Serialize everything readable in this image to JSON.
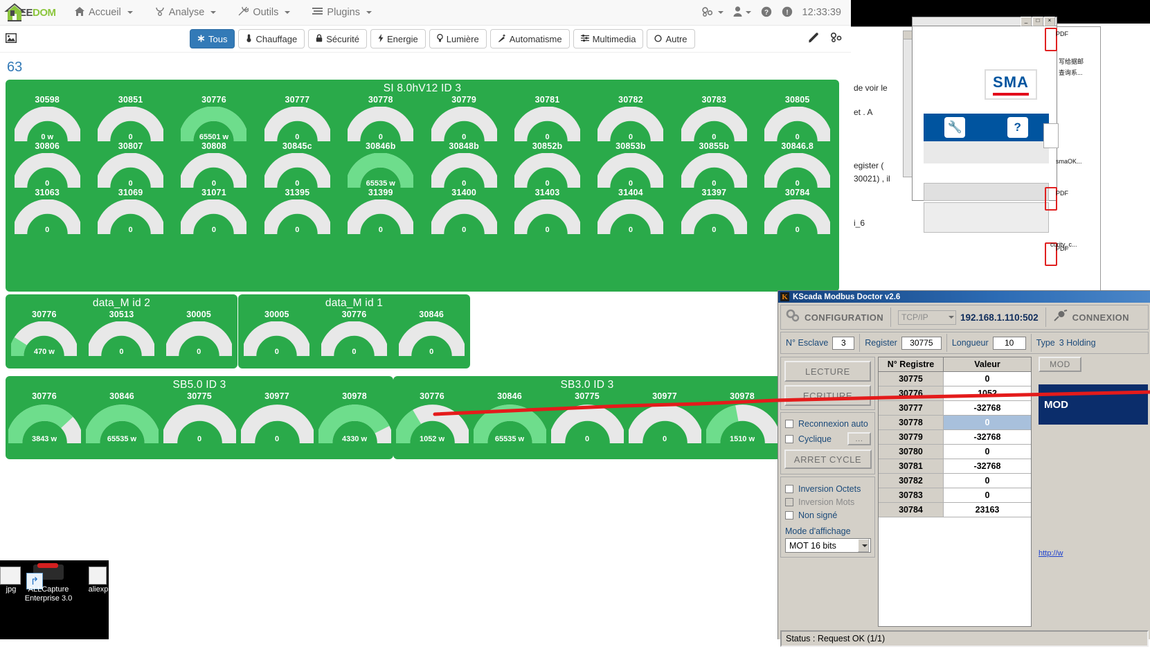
{
  "jeedom": {
    "brand": {
      "ee": "EE",
      "dom": "DOM"
    },
    "nav": [
      {
        "label": "Accueil",
        "icon": "home-icon"
      },
      {
        "label": "Analyse",
        "icon": "chart-icon"
      },
      {
        "label": "Outils",
        "icon": "wrench-icon"
      },
      {
        "label": "Plugins",
        "icon": "list-icon"
      }
    ],
    "nav_right": {
      "gears": "⚙",
      "user": "user-icon",
      "help": "?",
      "info": "!",
      "clock": "12:33:39"
    },
    "categories": [
      {
        "label": "Tous",
        "icon": "asterisk-icon",
        "active": true
      },
      {
        "label": "Chauffage",
        "icon": "thermometer-icon",
        "active": false
      },
      {
        "label": "Sécurité",
        "icon": "lock-icon",
        "active": false
      },
      {
        "label": "Energie",
        "icon": "bolt-icon",
        "active": false
      },
      {
        "label": "Lumière",
        "icon": "bulb-icon",
        "active": false
      },
      {
        "label": "Automatisme",
        "icon": "magic-icon",
        "active": false
      },
      {
        "label": "Multimedia",
        "icon": "sliders-icon",
        "active": false
      },
      {
        "label": "Autre",
        "icon": "circle-icon",
        "active": false
      }
    ],
    "page_number": "63",
    "panels": [
      {
        "id": "si80hv12",
        "title": "SI 8.0hV12 ID 3",
        "rows": [
          [
            {
              "label": "30598",
              "value": "0 w",
              "pct": 0
            },
            {
              "label": "30851",
              "value": "0",
              "pct": 0
            },
            {
              "label": "30776",
              "value": "65501 w",
              "pct": 100
            },
            {
              "label": "30777",
              "value": "0",
              "pct": 0
            },
            {
              "label": "30778",
              "value": "0",
              "pct": 0
            },
            {
              "label": "30779",
              "value": "0",
              "pct": 0
            },
            {
              "label": "30781",
              "value": "0",
              "pct": 0
            },
            {
              "label": "30782",
              "value": "0",
              "pct": 0
            },
            {
              "label": "30783",
              "value": "0",
              "pct": 0
            },
            {
              "label": "30805",
              "value": "0",
              "pct": 0
            }
          ],
          [
            {
              "label": "30806",
              "value": "0",
              "pct": 0
            },
            {
              "label": "30807",
              "value": "0",
              "pct": 0
            },
            {
              "label": "30808",
              "value": "0",
              "pct": 0
            },
            {
              "label": "30845c",
              "value": "0",
              "pct": 0
            },
            {
              "label": "30846b",
              "value": "65535 w",
              "pct": 100
            },
            {
              "label": "30848b",
              "value": "0",
              "pct": 0
            },
            {
              "label": "30852b",
              "value": "0",
              "pct": 0
            },
            {
              "label": "30853b",
              "value": "0",
              "pct": 0
            },
            {
              "label": "30855b",
              "value": "0",
              "pct": 0
            },
            {
              "label": "30846.8",
              "value": "0",
              "pct": 0
            }
          ],
          [
            {
              "label": "31063",
              "value": "0",
              "pct": 0
            },
            {
              "label": "31069",
              "value": "0",
              "pct": 0
            },
            {
              "label": "31071",
              "value": "0",
              "pct": 0
            },
            {
              "label": "31395",
              "value": "0",
              "pct": 0
            },
            {
              "label": "31399",
              "value": "0",
              "pct": 0
            },
            {
              "label": "31400",
              "value": "0",
              "pct": 0
            },
            {
              "label": "31403",
              "value": "0",
              "pct": 0
            },
            {
              "label": "31404",
              "value": "0",
              "pct": 0
            },
            {
              "label": "31397",
              "value": "0",
              "pct": 0
            },
            {
              "label": "30784",
              "value": "0",
              "pct": 0
            }
          ]
        ]
      },
      {
        "id": "data_m_id2",
        "title": "data_M id 2",
        "rows": [
          [
            {
              "label": "30776",
              "value": "470 w",
              "pct": 18
            },
            {
              "label": "30513",
              "value": "0",
              "pct": 0
            },
            {
              "label": "30005",
              "value": "0",
              "pct": 0
            }
          ]
        ]
      },
      {
        "id": "data_m_id1",
        "title": "data_M id 1",
        "rows": [
          [
            {
              "label": "30005",
              "value": "0",
              "pct": 0
            },
            {
              "label": "30776",
              "value": "0",
              "pct": 0
            },
            {
              "label": "30846",
              "value": "0",
              "pct": 0
            }
          ]
        ]
      },
      {
        "id": "sb50id3",
        "title": "SB5.0 ID 3",
        "rows": [
          [
            {
              "label": "30776",
              "value": "3843 w",
              "pct": 76
            },
            {
              "label": "30846",
              "value": "65535 w",
              "pct": 100
            },
            {
              "label": "30775",
              "value": "0",
              "pct": 0
            },
            {
              "label": "30977",
              "value": "0",
              "pct": 0
            },
            {
              "label": "30978",
              "value": "4330 w",
              "pct": 85
            }
          ]
        ]
      },
      {
        "id": "sb30id3",
        "title": "SB3.0 ID 3",
        "rows": [
          [
            {
              "label": "30776",
              "value": "1052 w",
              "pct": 33
            },
            {
              "label": "30846",
              "value": "65535 w",
              "pct": 100
            },
            {
              "label": "30775",
              "value": "0",
              "pct": 0
            },
            {
              "label": "30977",
              "value": "0",
              "pct": 0
            },
            {
              "label": "30978",
              "value": "1510 w",
              "pct": 44
            }
          ]
        ]
      }
    ],
    "colors": {
      "panel_green": "#2aaa4a",
      "gauge_fill": "#6edd8c",
      "gauge_track": "#e8e8e8",
      "accent_blue": "#337ab7"
    }
  },
  "modbus": {
    "title": "KScada Modbus Doctor v2.6",
    "config_label": "CONFIGURATION",
    "protocol": "TCP/IP",
    "ip": "192.168.1.110:502",
    "connexion_label": "CONNEXION",
    "fields": {
      "slave_label": "N° Esclave",
      "slave_value": "3",
      "register_label": "Register",
      "register_value": "30775",
      "length_label": "Longueur",
      "length_value": "10",
      "type_label": "Type",
      "type_value": "3 Holding"
    },
    "buttons": {
      "read": "LECTURE",
      "write": "ECRITURE",
      "stop_cycle": "ARRET CYCLE",
      "mod1": "MOD",
      "mod2": "MOD"
    },
    "checkboxes": [
      {
        "label": "Reconnexion auto",
        "checked": false,
        "disabled": false
      },
      {
        "label": "Cyclique",
        "checked": false,
        "disabled": false
      },
      {
        "label": "Inversion Octets",
        "checked": false,
        "disabled": false
      },
      {
        "label": "Inversion Mots",
        "checked": false,
        "disabled": true
      },
      {
        "label": "Non signé",
        "checked": false,
        "disabled": false
      }
    ],
    "cyclique_btn": "...",
    "display_mode_label": "Mode d'affichage",
    "display_mode_value": "MOT 16 bits",
    "table": {
      "headers": [
        "N° Registre",
        "Valeur"
      ],
      "rows": [
        {
          "reg": "30775",
          "val": "0",
          "selected": false
        },
        {
          "reg": "30776",
          "val": "1052",
          "selected": false
        },
        {
          "reg": "30777",
          "val": "-32768",
          "selected": false
        },
        {
          "reg": "30778",
          "val": "0",
          "selected": true
        },
        {
          "reg": "30779",
          "val": "-32768",
          "selected": false
        },
        {
          "reg": "30780",
          "val": "0",
          "selected": false
        },
        {
          "reg": "30781",
          "val": "-32768",
          "selected": false
        },
        {
          "reg": "30782",
          "val": "0",
          "selected": false
        },
        {
          "reg": "30783",
          "val": "0",
          "selected": false
        },
        {
          "reg": "30784",
          "val": "23163",
          "selected": false
        }
      ]
    },
    "status": "Status : Request OK (1/1)"
  },
  "background": {
    "sma_logo": "SMA",
    "window_text": [
      "de voir le",
      "et . A",
      "egister (",
      "30021) , il",
      "i_6"
    ],
    "right_labels": [
      "写给据邮",
      "查询系...",
      "smaOK...",
      "curity_c...",
      "PDF",
      "PDF",
      "PDF"
    ],
    "link": "http://w"
  },
  "desktop": {
    "icons": [
      {
        "label": "jpg"
      },
      {
        "label": "ALLCapture\nEnterprise 3.0"
      },
      {
        "label": "aliexp"
      }
    ]
  }
}
